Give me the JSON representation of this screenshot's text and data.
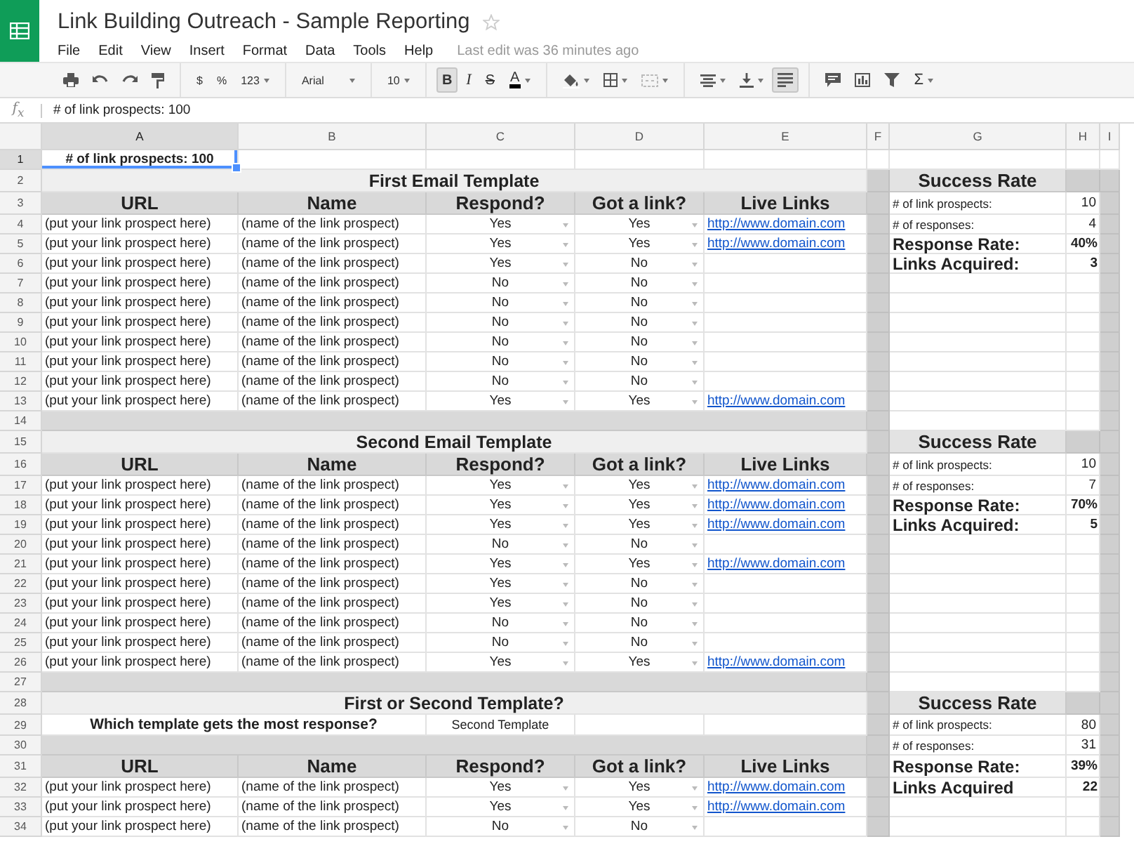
{
  "app": {
    "title": "Link Building Outreach - Sample Reporting",
    "starred": false,
    "menu": [
      "File",
      "Edit",
      "View",
      "Insert",
      "Format",
      "Data",
      "Tools",
      "Help"
    ],
    "last_edit": "Last edit was 36 minutes ago"
  },
  "toolbar": {
    "currency": "$",
    "percent": "%",
    "number_format": "123",
    "font": "Arial",
    "font_size": "10",
    "bold": "B",
    "bold_active": true,
    "italic": "I",
    "strikethrough": "S",
    "text_color": "A",
    "sum": "Σ"
  },
  "formula_bar": {
    "label": "f$_{x}$",
    "value": "# of link prospects: 100"
  },
  "columns": [
    {
      "label": "A",
      "selected": true
    },
    {
      "label": "B",
      "selected": false
    },
    {
      "label": "C",
      "selected": false
    },
    {
      "label": "D",
      "selected": false
    },
    {
      "label": "E",
      "selected": false
    },
    {
      "label": "F",
      "selected": false
    },
    {
      "label": "G",
      "selected": false
    },
    {
      "label": "H",
      "selected": false
    },
    {
      "label": "I",
      "selected": false
    }
  ],
  "rows": [
    {
      "number": "1",
      "selected": true,
      "kind": "note",
      "note": "# of link prospects: 100",
      "focused": true
    },
    {
      "number": "2",
      "selected": false,
      "kind": "title",
      "text": "First Email Template",
      "side": {
        "kind": "title",
        "text": "Success Rate"
      }
    },
    {
      "number": "3",
      "selected": false,
      "kind": "header",
      "cells": [
        "URL",
        "Name",
        "Respond?",
        "Got a link?",
        "Live Links"
      ],
      "side": {
        "kind": "stat",
        "label": "# of link prospects:",
        "value": "10"
      }
    },
    {
      "number": "4",
      "selected": false,
      "kind": "data",
      "url": "(put your link prospect here)",
      "name": "(name of the link prospect)",
      "respond": "Yes",
      "got_link": "Yes",
      "live_link": "http://www.domain.com",
      "side": {
        "kind": "stat",
        "label": "# of responses:",
        "value": "4"
      }
    },
    {
      "number": "5",
      "selected": false,
      "kind": "data",
      "url": "(put your link prospect here)",
      "name": "(name of the link prospect)",
      "respond": "Yes",
      "got_link": "Yes",
      "live_link": "http://www.domain.com",
      "side": {
        "kind": "key_stat",
        "label": "Response Rate:",
        "value": "40%"
      }
    },
    {
      "number": "6",
      "selected": false,
      "kind": "data",
      "url": "(put your link prospect here)",
      "name": "(name of the link prospect)",
      "respond": "Yes",
      "got_link": "No",
      "side": {
        "kind": "key_stat",
        "label": "Links Acquired:",
        "value": "3"
      }
    },
    {
      "number": "7",
      "selected": false,
      "kind": "data",
      "url": "(put your link prospect here)",
      "name": "(name of the link prospect)",
      "respond": "No",
      "got_link": "No"
    },
    {
      "number": "8",
      "selected": false,
      "kind": "data",
      "url": "(put your link prospect here)",
      "name": "(name of the link prospect)",
      "respond": "No",
      "got_link": "No"
    },
    {
      "number": "9",
      "selected": false,
      "kind": "data",
      "url": "(put your link prospect here)",
      "name": "(name of the link prospect)",
      "respond": "No",
      "got_link": "No"
    },
    {
      "number": "10",
      "selected": false,
      "kind": "data",
      "url": "(put your link prospect here)",
      "name": "(name of the link prospect)",
      "respond": "No",
      "got_link": "No"
    },
    {
      "number": "11",
      "selected": false,
      "kind": "data",
      "url": "(put your link prospect here)",
      "name": "(name of the link prospect)",
      "respond": "No",
      "got_link": "No"
    },
    {
      "number": "12",
      "selected": false,
      "kind": "data",
      "url": "(put your link prospect here)",
      "name": "(name of the link prospect)",
      "respond": "No",
      "got_link": "No"
    },
    {
      "number": "13",
      "selected": false,
      "kind": "data",
      "url": "(put your link prospect here)",
      "name": "(name of the link prospect)",
      "respond": "Yes",
      "got_link": "Yes",
      "live_link": "http://www.domain.com"
    },
    {
      "number": "14",
      "selected": false,
      "kind": "gap"
    },
    {
      "number": "15",
      "selected": false,
      "kind": "title",
      "text": "Second Email Template",
      "side": {
        "kind": "title",
        "text": "Success Rate"
      }
    },
    {
      "number": "16",
      "selected": false,
      "kind": "header",
      "cells": [
        "URL",
        "Name",
        "Respond?",
        "Got a link?",
        "Live Links"
      ],
      "side": {
        "kind": "stat",
        "label": "# of link prospects:",
        "value": "10"
      }
    },
    {
      "number": "17",
      "selected": false,
      "kind": "data",
      "url": "(put your link prospect here)",
      "name": "(name of the link prospect)",
      "respond": "Yes",
      "got_link": "Yes",
      "live_link": "http://www.domain.com",
      "side": {
        "kind": "stat",
        "label": "# of responses:",
        "value": "7"
      }
    },
    {
      "number": "18",
      "selected": false,
      "kind": "data",
      "url": "(put your link prospect here)",
      "name": "(name of the link prospect)",
      "respond": "Yes",
      "got_link": "Yes",
      "live_link": "http://www.domain.com",
      "side": {
        "kind": "key_stat",
        "label": "Response Rate:",
        "value": "70%"
      }
    },
    {
      "number": "19",
      "selected": false,
      "kind": "data",
      "url": "(put your link prospect here)",
      "name": "(name of the link prospect)",
      "respond": "Yes",
      "got_link": "Yes",
      "live_link": "http://www.domain.com",
      "side": {
        "kind": "key_stat",
        "label": "Links Acquired:",
        "value": "5"
      }
    },
    {
      "number": "20",
      "selected": false,
      "kind": "data",
      "url": "(put your link prospect here)",
      "name": "(name of the link prospect)",
      "respond": "No",
      "got_link": "No"
    },
    {
      "number": "21",
      "selected": false,
      "kind": "data",
      "url": "(put your link prospect here)",
      "name": "(name of the link prospect)",
      "respond": "Yes",
      "got_link": "Yes",
      "live_link": "http://www.domain.com"
    },
    {
      "number": "22",
      "selected": false,
      "kind": "data",
      "url": "(put your link prospect here)",
      "name": "(name of the link prospect)",
      "respond": "Yes",
      "got_link": "No"
    },
    {
      "number": "23",
      "selected": false,
      "kind": "data",
      "url": "(put your link prospect here)",
      "name": "(name of the link prospect)",
      "respond": "Yes",
      "got_link": "No"
    },
    {
      "number": "24",
      "selected": false,
      "kind": "data",
      "url": "(put your link prospect here)",
      "name": "(name of the link prospect)",
      "respond": "No",
      "got_link": "No"
    },
    {
      "number": "25",
      "selected": false,
      "kind": "data",
      "url": "(put your link prospect here)",
      "name": "(name of the link prospect)",
      "respond": "No",
      "got_link": "No"
    },
    {
      "number": "26",
      "selected": false,
      "kind": "data",
      "url": "(put your link prospect here)",
      "name": "(name of the link prospect)",
      "respond": "Yes",
      "got_link": "Yes",
      "live_link": "http://www.domain.com"
    },
    {
      "number": "27",
      "selected": false,
      "kind": "gap"
    },
    {
      "number": "28",
      "selected": false,
      "kind": "title",
      "text": "First or Second Template?",
      "side": {
        "kind": "title",
        "text": "Success Rate"
      }
    },
    {
      "number": "29",
      "selected": false,
      "kind": "question",
      "question": "Which template gets the most response?",
      "answer": "Second Template",
      "side": {
        "kind": "stat",
        "label": "# of link prospects:",
        "value": "80"
      }
    },
    {
      "number": "30",
      "selected": false,
      "kind": "gap",
      "side": {
        "kind": "stat",
        "label": "# of responses:",
        "value": "31"
      }
    },
    {
      "number": "31",
      "selected": false,
      "kind": "header",
      "cells": [
        "URL",
        "Name",
        "Respond?",
        "Got a link?",
        "Live Links"
      ],
      "side": {
        "kind": "key_stat",
        "label": "Response Rate:",
        "value": "39%"
      }
    },
    {
      "number": "32",
      "selected": false,
      "kind": "data",
      "url": "(put your link prospect here)",
      "name": "(name of the link prospect)",
      "respond": "Yes",
      "got_link": "Yes",
      "live_link": "http://www.domain.com",
      "side": {
        "kind": "key_stat",
        "label": "Links Acquired",
        "value": "22"
      }
    },
    {
      "number": "33",
      "selected": false,
      "kind": "data",
      "url": "(put your link prospect here)",
      "name": "(name of the link prospect)",
      "respond": "Yes",
      "got_link": "Yes",
      "live_link": "http://www.domain.com"
    },
    {
      "number": "34",
      "selected": false,
      "kind": "data",
      "url": "(put your link prospect here)",
      "name": "(name of the link prospect)",
      "respond": "No",
      "got_link": "No"
    }
  ]
}
